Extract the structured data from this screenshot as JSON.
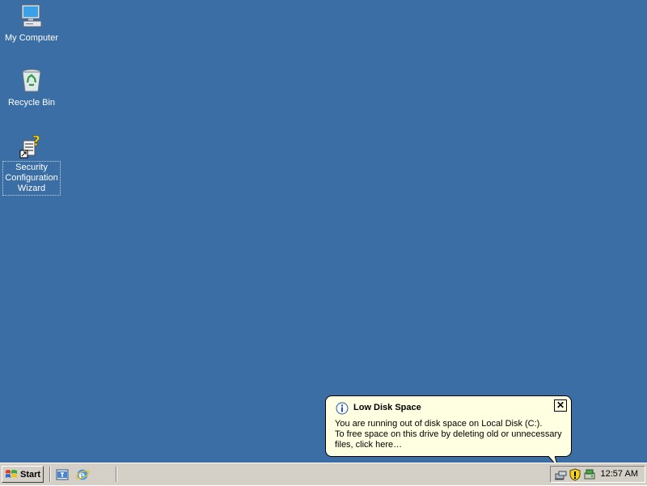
{
  "desktop": {
    "background_color": "#3a6ea5",
    "icons": [
      {
        "label": "My Computer",
        "icon": "computer-icon"
      },
      {
        "label": "Recycle Bin",
        "icon": "recycle-bin-icon"
      },
      {
        "label_lines": [
          "Security",
          "Configuration",
          "Wizard"
        ],
        "icon": "security-wizard-icon"
      }
    ]
  },
  "taskbar": {
    "start_label": "Start",
    "quick_launch": [
      "show-desktop-icon",
      "internet-explorer-icon"
    ],
    "tray_icons": [
      "network-icon",
      "security-alert-icon",
      "low-disk-icon"
    ],
    "clock": "12:57 AM"
  },
  "balloon": {
    "title": "Low Disk Space",
    "lines": [
      "You are running out of disk space on Local Disk (C:).",
      "To free space on this drive by deleting old or unnecessary",
      "files, click here…"
    ],
    "close_label": "✕",
    "bg_color": "#ffffe1"
  }
}
